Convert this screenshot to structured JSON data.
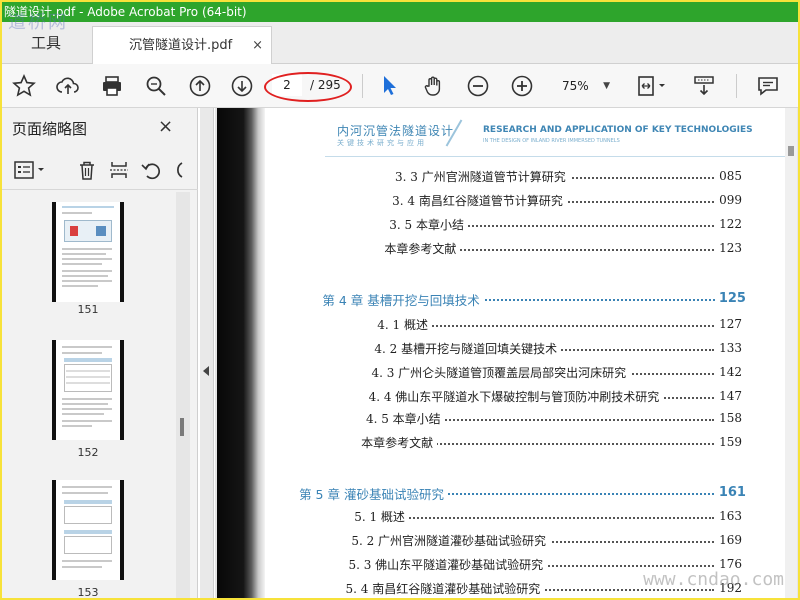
{
  "window": {
    "title": "隧道设计.pdf - Adobe Acrobat Pro (64-bit)"
  },
  "tabs": {
    "tools": "工具",
    "document": "沉管隧道设计.pdf",
    "close": "×"
  },
  "toolbar": {
    "page_current": "2",
    "page_total": "/ 295",
    "zoom": "75%",
    "zoom_caret": "▼"
  },
  "sidebar": {
    "title": "页面缩略图",
    "close": "×",
    "thumbnails": [
      {
        "label": "151"
      },
      {
        "label": "152"
      },
      {
        "label": "153"
      }
    ]
  },
  "document": {
    "header_cn": "内河沉管法隧道设计",
    "header_sub": "关键技术研究与应用",
    "header_en": "RESEARCH AND APPLICATION OF KEY TECHNOLOGIES",
    "header_en2": "IN THE DESIGN OF INLAND RIVER IMMERSED TUNNELS",
    "toc": [
      {
        "text": "3. 3  广州官洲隧道管节计算研究",
        "page": "085",
        "type": "section"
      },
      {
        "text": "3. 4  南昌红谷隧道管节计算研究",
        "page": "099",
        "type": "section"
      },
      {
        "text": "3. 5  本章小结",
        "page": "122",
        "type": "section"
      },
      {
        "text": "本章参考文献",
        "page": "123",
        "type": "ref"
      },
      {
        "text": "第 4 章   基槽开挖与回填技术",
        "page": "125",
        "type": "chapter"
      },
      {
        "text": "4. 1  概述",
        "page": "127",
        "type": "section"
      },
      {
        "text": "4. 2  基槽开挖与隧道回填关键技术",
        "page": "133",
        "type": "section"
      },
      {
        "text": "4. 3  广州仑头隧道管顶覆盖层局部突出河床研究",
        "page": "142",
        "type": "section"
      },
      {
        "text": "4. 4  佛山东平隧道水下爆破控制与管顶防冲刷技术研究",
        "page": "147",
        "type": "section"
      },
      {
        "text": "4. 5  本章小结",
        "page": "158",
        "type": "section"
      },
      {
        "text": "本章参考文献",
        "page": "159",
        "type": "ref"
      },
      {
        "text": "第 5 章   灌砂基础试验研究",
        "page": "161",
        "type": "chapter"
      },
      {
        "text": "5. 1  概述",
        "page": "163",
        "type": "section"
      },
      {
        "text": "5. 2  广州官洲隧道灌砂基础试验研究",
        "page": "169",
        "type": "section"
      },
      {
        "text": "5. 3  佛山东平隧道灌砂基础试验研究",
        "page": "176",
        "type": "section"
      },
      {
        "text": "5. 4  南昌红谷隧道灌砂基础试验研究",
        "page": "192",
        "type": "section"
      }
    ]
  },
  "watermarks": {
    "top_left": "道桥网",
    "bottom_right": "www.cndao.com"
  },
  "colors": {
    "titlebar": "#2ea52c",
    "accent": "#3a83b5",
    "annotation": "#e02020",
    "frame": "#f7e23a"
  }
}
